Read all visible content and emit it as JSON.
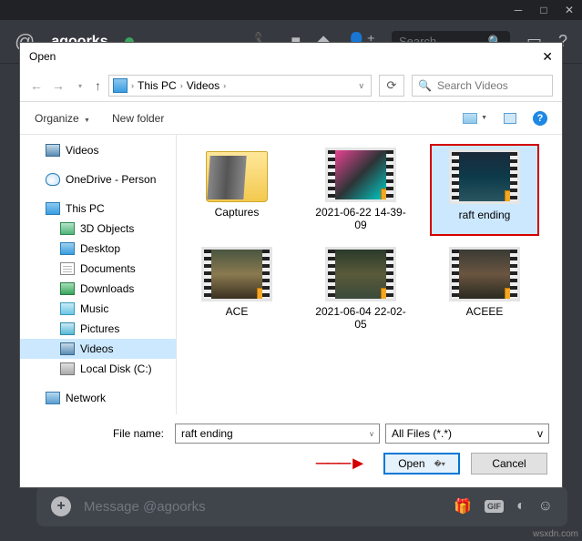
{
  "discord": {
    "username": "agoorks",
    "search_placeholder": "Search",
    "message_placeholder": "Message @agoorks",
    "gif_label": "GIF"
  },
  "dialog": {
    "title": "Open",
    "breadcrumb": {
      "root": "This PC",
      "folder": "Videos"
    },
    "search_placeholder": "Search Videos",
    "toolbar": {
      "organize": "Organize",
      "new_folder": "New folder"
    },
    "tree": {
      "videos_top": "Videos",
      "onedrive": "OneDrive - Person",
      "this_pc": "This PC",
      "objects3d": "3D Objects",
      "desktop": "Desktop",
      "documents": "Documents",
      "downloads": "Downloads",
      "music": "Music",
      "pictures": "Pictures",
      "videos": "Videos",
      "local_disk": "Local Disk (C:)",
      "network": "Network"
    },
    "files": [
      {
        "name": "Captures",
        "type": "folder"
      },
      {
        "name": "2021-06-22 14-39-09",
        "type": "video",
        "style": "vi1"
      },
      {
        "name": "raft ending",
        "type": "video",
        "style": "vi2",
        "selected": true
      },
      {
        "name": "ACE",
        "type": "video",
        "style": "vi3"
      },
      {
        "name": "2021-06-04 22-02-05",
        "type": "video",
        "style": "vi4"
      },
      {
        "name": "ACEEE",
        "type": "video",
        "style": "vi5"
      }
    ],
    "footer": {
      "filename_label": "File name:",
      "filename_value": "raft ending",
      "filter": "All Files (*.*)",
      "open": "Open",
      "cancel": "Cancel"
    }
  },
  "watermark": "wsxdn.com"
}
